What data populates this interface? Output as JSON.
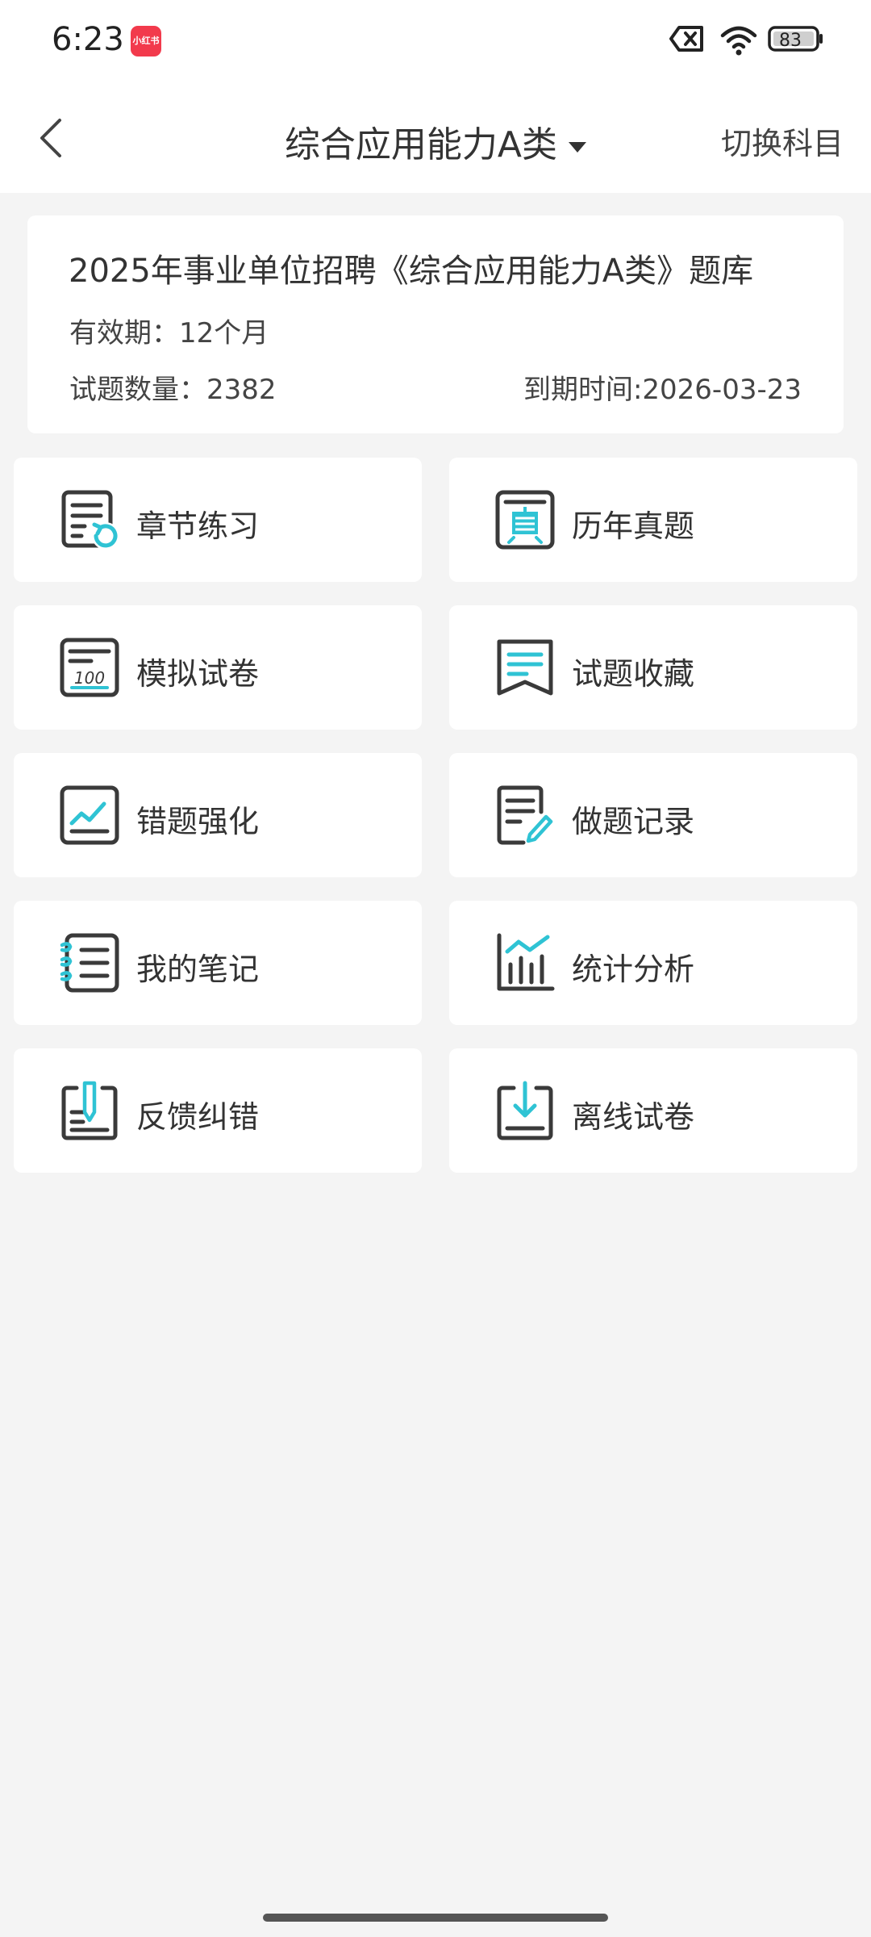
{
  "status_bar": {
    "time": "6:23",
    "app_badge": "小红书",
    "battery": "83"
  },
  "nav": {
    "subject": "综合应用能力A类",
    "switch_label": "切换科目"
  },
  "info": {
    "title": "2025年事业单位招聘《综合应用能力A类》题库",
    "validity": "有效期：12个月",
    "question_count": "试题数量：2382",
    "expiry": "到期时间:2026-03-23"
  },
  "menu": [
    {
      "label": "章节练习",
      "icon": "chapter-practice-icon"
    },
    {
      "label": "历年真题",
      "icon": "past-exams-icon"
    },
    {
      "label": "模拟试卷",
      "icon": "mock-exam-icon"
    },
    {
      "label": "试题收藏",
      "icon": "bookmark-icon"
    },
    {
      "label": "错题强化",
      "icon": "mistake-review-icon"
    },
    {
      "label": "做题记录",
      "icon": "practice-record-icon"
    },
    {
      "label": "我的笔记",
      "icon": "notes-icon"
    },
    {
      "label": "统计分析",
      "icon": "statistics-icon"
    },
    {
      "label": "反馈纠错",
      "icon": "feedback-icon"
    },
    {
      "label": "离线试卷",
      "icon": "offline-download-icon"
    }
  ],
  "colors": {
    "icon_dark": "#3a3a3a",
    "icon_accent": "#2fc3d4",
    "background": "#f4f4f4"
  }
}
